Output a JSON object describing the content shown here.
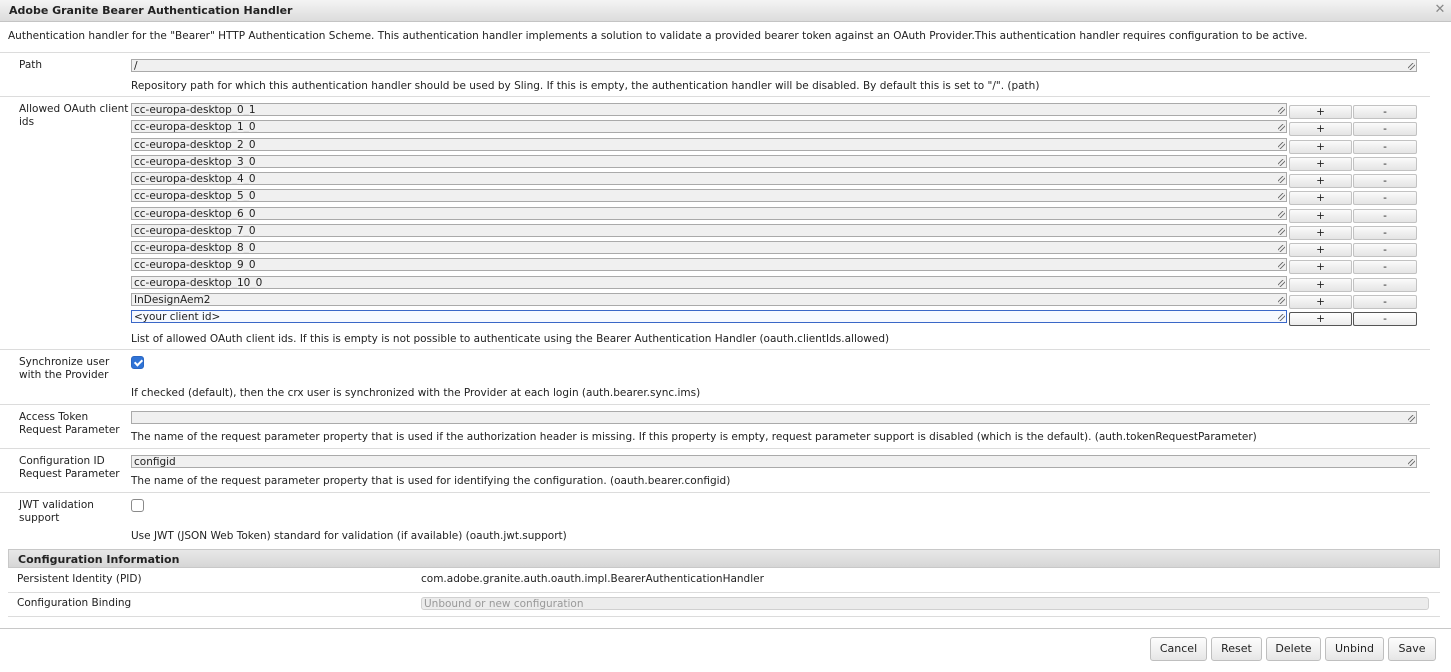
{
  "window": {
    "title": "Adobe Granite Bearer Authentication Handler",
    "close_glyph": "✕"
  },
  "description": "Authentication handler for the \"Bearer\" HTTP Authentication Scheme. This authentication handler implements a solution to validate a provided bearer token against an OAuth Provider.This authentication handler requires configuration to be active.",
  "path": {
    "label": "Path",
    "value": "/",
    "help": "Repository path for which this authentication handler should be used by Sling. If this is empty, the authentication handler will be disabled. By default this is set to \"/\". (path)"
  },
  "client_ids": {
    "label": "Allowed OAuth client ids",
    "values": [
      "cc-europa-desktop_0_1",
      "cc-europa-desktop_1_0",
      "cc-europa-desktop_2_0",
      "cc-europa-desktop_3_0",
      "cc-europa-desktop_4_0",
      "cc-europa-desktop_5_0",
      "cc-europa-desktop_6_0",
      "cc-europa-desktop_7_0",
      "cc-europa-desktop_8_0",
      "cc-europa-desktop_9_0",
      "cc-europa-desktop_10_0",
      "InDesignAem2",
      "<your client id>"
    ],
    "add_label": "+",
    "remove_label": "-",
    "help": "List of allowed OAuth client ids. If this is empty is not possible to authenticate using the Bearer Authentication Handler (oauth.clientIds.allowed)"
  },
  "sync": {
    "label": "Synchronize user with the Provider",
    "checked": true,
    "help": "If checked (default), then the crx user is synchronized with the Provider at each login (auth.bearer.sync.ims)"
  },
  "token_param": {
    "label": "Access Token Request Parameter",
    "value": "",
    "help": "The name of the request parameter property that is used if the authorization header is missing. If this property is empty, request parameter support is disabled (which is the default). (auth.tokenRequestParameter)"
  },
  "config_id": {
    "label": "Configuration ID Request Parameter",
    "value": "configid",
    "help": "The name of the request parameter property that is used for identifying the configuration. (oauth.bearer.configid)"
  },
  "jwt": {
    "label": "JWT validation support",
    "checked": false,
    "help": "Use JWT (JSON Web Token) standard for validation (if available) (oauth.jwt.support)"
  },
  "config_info": {
    "header": "Configuration Information",
    "pid_label": "Persistent Identity (PID)",
    "pid_value": "com.adobe.granite.auth.oauth.impl.BearerAuthenticationHandler",
    "binding_label": "Configuration Binding",
    "binding_value": "Unbound or new configuration"
  },
  "footer": {
    "cancel": "Cancel",
    "reset": "Reset",
    "delete": "Delete",
    "unbind": "Unbind",
    "save": "Save"
  }
}
